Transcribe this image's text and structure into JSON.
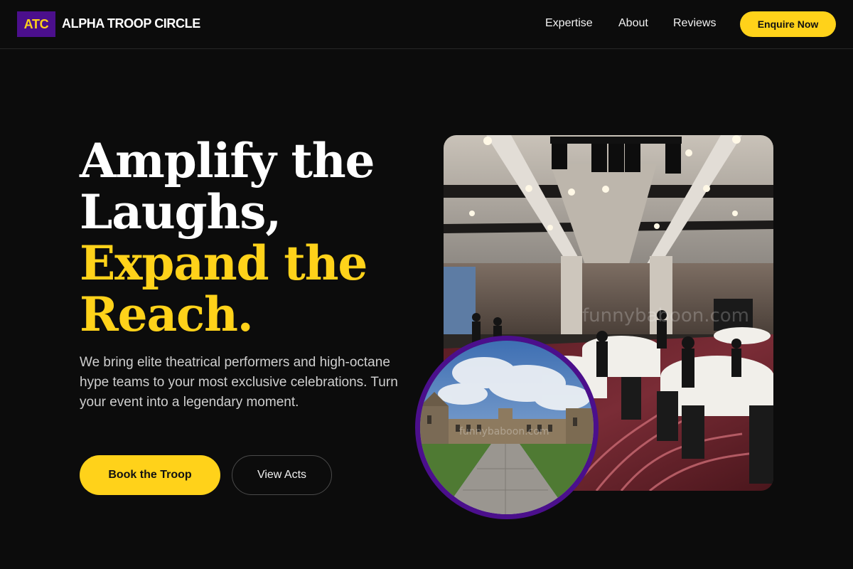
{
  "brand": {
    "logo_text": "ATC",
    "name": "ALPHA TROOP CIRCLE"
  },
  "nav": {
    "links": [
      "Expertise",
      "About",
      "Reviews"
    ],
    "cta_label": "Enquire Now"
  },
  "hero": {
    "headline_line1": "Amplify the",
    "headline_line2": "Laughs,",
    "headline_line3": "Expand the",
    "headline_line4": "Reach.",
    "subtext": "We bring elite theatrical performers and high-octane hype teams to your most exclusive celebrations. Turn your event into a legendary moment.",
    "primary_button": "Book the Troop",
    "secondary_button": "View Acts"
  },
  "colors": {
    "accent_yellow": "#ffd21a",
    "brand_purple": "#4b0f8c",
    "background": "#0c0c0c"
  },
  "images": {
    "main": "banquet-hall-photo",
    "inset": "campus-quadrangle-photo"
  }
}
